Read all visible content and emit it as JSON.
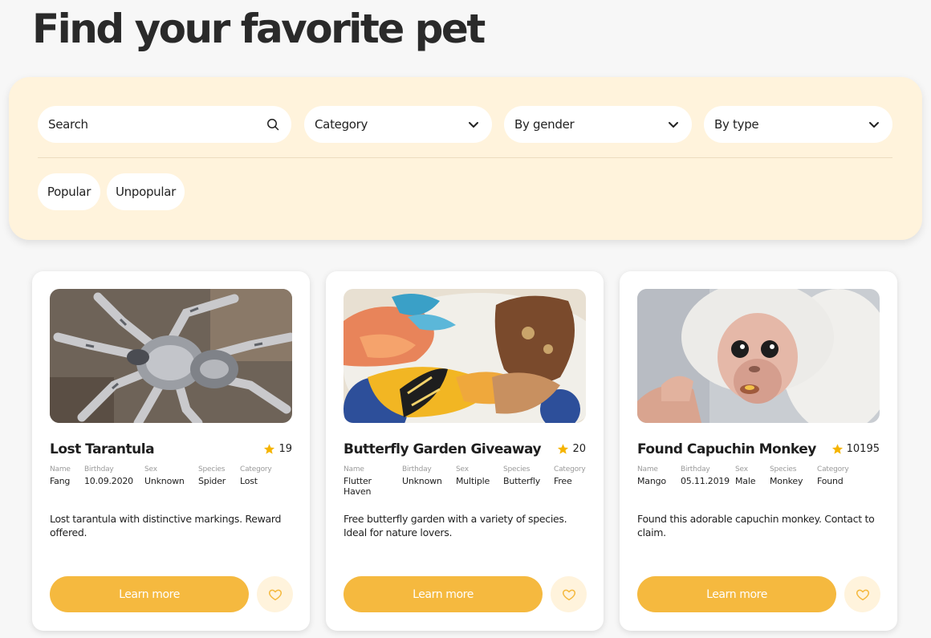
{
  "page": {
    "title": "Find your favorite pet"
  },
  "filters": {
    "search_placeholder": "Search",
    "category_label": "Category",
    "gender_label": "By gender",
    "type_label": "By type",
    "chips": [
      "Popular",
      "Unpopular"
    ]
  },
  "meta_labels": [
    "Name",
    "Birthday",
    "Sex",
    "Species",
    "Category"
  ],
  "cards": [
    {
      "title": "Lost Tarantula",
      "rating": "19",
      "name": "Fang",
      "birthday": "10.09.2020",
      "sex": "Unknown",
      "species": "Spider",
      "category": "Lost",
      "description": "Lost tarantula with distinctive markings. Reward offered.",
      "button": "Learn more",
      "image": "tarantula-photo"
    },
    {
      "title": "Butterfly Garden Giveaway",
      "rating": "20",
      "name": "Flutter Haven",
      "birthday": "Unknown",
      "sex": "Multiple",
      "species": "Butterfly",
      "category": "Free",
      "description": "Free butterfly garden with a variety of species. Ideal for nature lovers.",
      "button": "Learn more",
      "image": "butterfly-photo"
    },
    {
      "title": "Found Capuchin Monkey",
      "rating": "10195",
      "name": "Mango",
      "birthday": "05.11.2019",
      "sex": "Male",
      "species": "Monkey",
      "category": "Found",
      "description": "Found this adorable capuchin monkey. Contact to claim.",
      "button": "Learn more",
      "image": "monkey-photo"
    }
  ],
  "colors": {
    "accent": "#f5b93f",
    "panel": "#fff3dc",
    "star": "#f5b400",
    "background": "#f7f7f7"
  }
}
